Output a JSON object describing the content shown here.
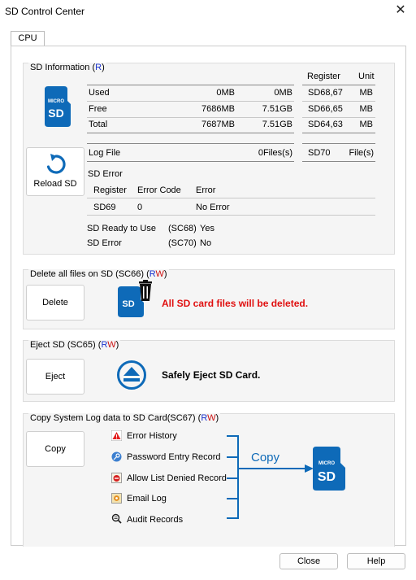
{
  "window": {
    "title": "SD Control Center"
  },
  "tabs": [
    {
      "label": "CPU"
    }
  ],
  "sd_info": {
    "legend": "SD Information",
    "legend_flag_open": "(",
    "legend_r": "R",
    "legend_flag_close": ")",
    "sd_icon_small": "MICRO",
    "sd_icon_big": "SD",
    "headers": {
      "register": "Register",
      "unit": "Unit"
    },
    "rows": [
      {
        "label": "Used",
        "mb": "0MB",
        "gb": "0MB",
        "register": "SD68,67",
        "unit": "MB"
      },
      {
        "label": "Free",
        "mb": "7686MB",
        "gb": "7.51GB",
        "register": "SD66,65",
        "unit": "MB"
      },
      {
        "label": "Total",
        "mb": "7687MB",
        "gb": "7.51GB",
        "register": "SD64,63",
        "unit": "MB"
      }
    ],
    "reload_label": "Reload SD",
    "log_file": {
      "label": "Log File",
      "value": "0Files(s)",
      "register": "SD70",
      "unit": "File(s)"
    },
    "sd_error": {
      "title": "SD Error",
      "headers": {
        "register": "Register",
        "code": "Error Code",
        "error": "Error"
      },
      "row": {
        "register": "SD69",
        "code": "0",
        "error": "No Error"
      }
    },
    "status": [
      {
        "label": "SD Ready to Use",
        "register": "(SC68)",
        "value": "Yes"
      },
      {
        "label": "SD Error",
        "register": "(SC70)",
        "value": "No"
      }
    ]
  },
  "delete_group": {
    "legend": "Delete all files on SD (SC66)",
    "legend_open": "(",
    "legend_r": "R",
    "legend_w": "W",
    "legend_close": ")",
    "button": "Delete",
    "warning": "All SD card files will be deleted.",
    "sd_text": "SD",
    "warning_color": "#e01010"
  },
  "eject_group": {
    "legend": "Eject SD (SC65)",
    "legend_open": "(",
    "legend_r": "R",
    "legend_w": "W",
    "legend_close": ")",
    "button": "Eject",
    "message": "Safely Eject SD Card."
  },
  "copy_group": {
    "legend": "Copy System Log data to SD Card(SC67)",
    "legend_open": "(",
    "legend_r": "R",
    "legend_w": "W",
    "legend_close": ")",
    "button": "Copy",
    "arrow_label": "Copy",
    "sd_icon_small": "MICRO",
    "sd_icon_big": "SD",
    "logs": [
      {
        "label": "Error History",
        "icon": "warning-icon"
      },
      {
        "label": "Password Entry Record",
        "icon": "key-icon"
      },
      {
        "label": "Allow List Denied Record",
        "icon": "denied-list-icon"
      },
      {
        "label": "Email Log",
        "icon": "email-icon"
      },
      {
        "label": "Audit Records",
        "icon": "audit-search-icon"
      }
    ]
  },
  "footer": {
    "close": "Close",
    "help": "Help"
  },
  "colors": {
    "accent_blue": "#0e6ab8",
    "red": "#e01010"
  }
}
